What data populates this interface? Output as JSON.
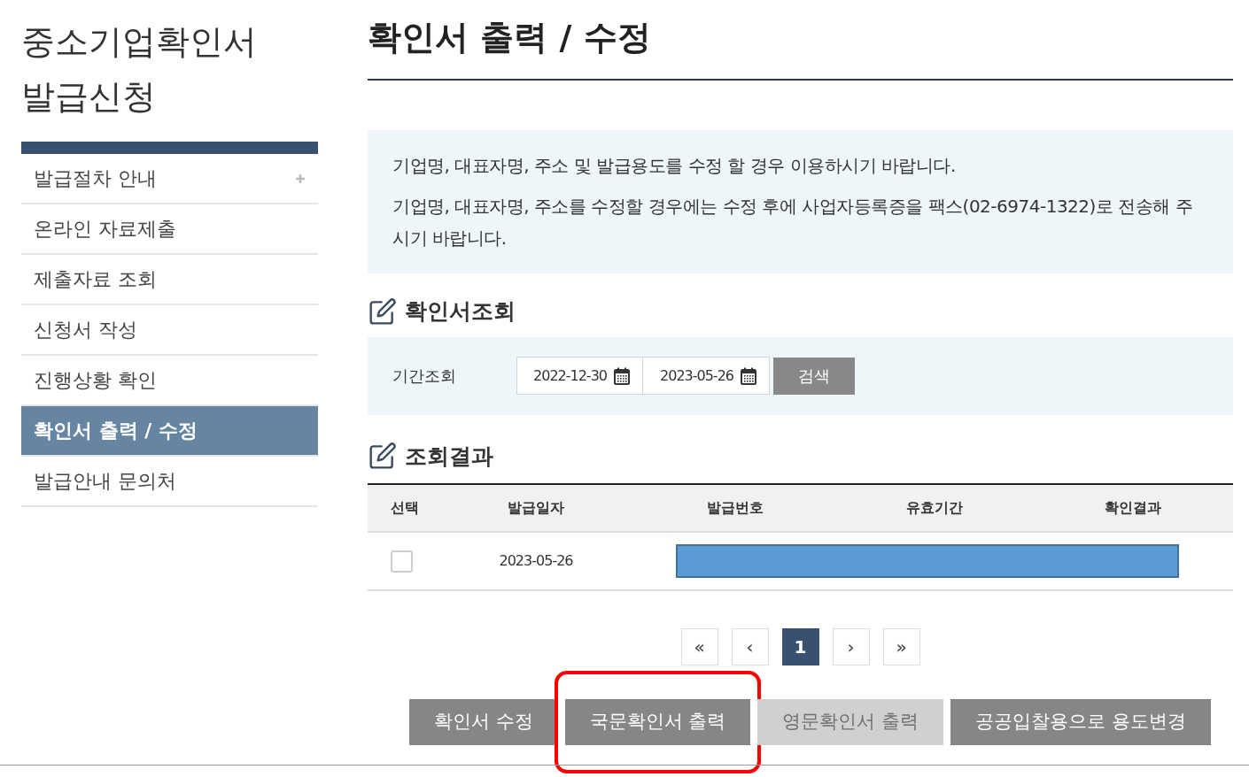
{
  "sidebar": {
    "title_lines": [
      "중소기업확인서",
      "발급신청"
    ],
    "items": [
      {
        "label": "발급절차 안내",
        "expandable": true,
        "selected": false
      },
      {
        "label": "온라인 자료제출",
        "expandable": false,
        "selected": false
      },
      {
        "label": "제출자료 조회",
        "expandable": false,
        "selected": false
      },
      {
        "label": "신청서 작성",
        "expandable": false,
        "selected": false
      },
      {
        "label": "진행상황 확인",
        "expandable": false,
        "selected": false
      },
      {
        "label": "확인서 출력 / 수정",
        "expandable": false,
        "selected": true
      },
      {
        "label": "발급안내 문의처",
        "expandable": false,
        "selected": false
      }
    ]
  },
  "page_title": "확인서 출력 / 수정",
  "notice": [
    "기업명, 대표자명, 주소 및 발급용도를 수정 할 경우 이용하시기 바랍니다.",
    "기업명, 대표자명, 주소를 수정할 경우에는 수정 후에 사업자등록증을 팩스(02-6974-1322)로 전송해 주시기 바랍니다."
  ],
  "search_section": {
    "heading": "확인서조회",
    "label": "기간조회",
    "start_date": "2022-12-30",
    "end_date": "2023-05-26",
    "button": "검색"
  },
  "results_section": {
    "heading": "조회결과",
    "columns": [
      "선택",
      "발급일자",
      "발급번호",
      "유효기간",
      "확인결과"
    ],
    "rows": [
      {
        "checked": false,
        "issue_date": "2023-05-26",
        "redacted": true
      }
    ]
  },
  "pagination": [
    {
      "label": "«",
      "selected": false
    },
    {
      "label": "‹",
      "selected": false
    },
    {
      "label": "1",
      "selected": true
    },
    {
      "label": "›",
      "selected": false
    },
    {
      "label": "»",
      "selected": false
    }
  ],
  "actions": [
    {
      "label": "확인서 수정",
      "disabled": false,
      "highlighted": false
    },
    {
      "label": "국문확인서 출력",
      "disabled": false,
      "highlighted": true
    },
    {
      "label": "영문확인서 출력",
      "disabled": true,
      "highlighted": false
    },
    {
      "label": "공공입찰용으로 용도변경",
      "disabled": false,
      "highlighted": false
    }
  ]
}
